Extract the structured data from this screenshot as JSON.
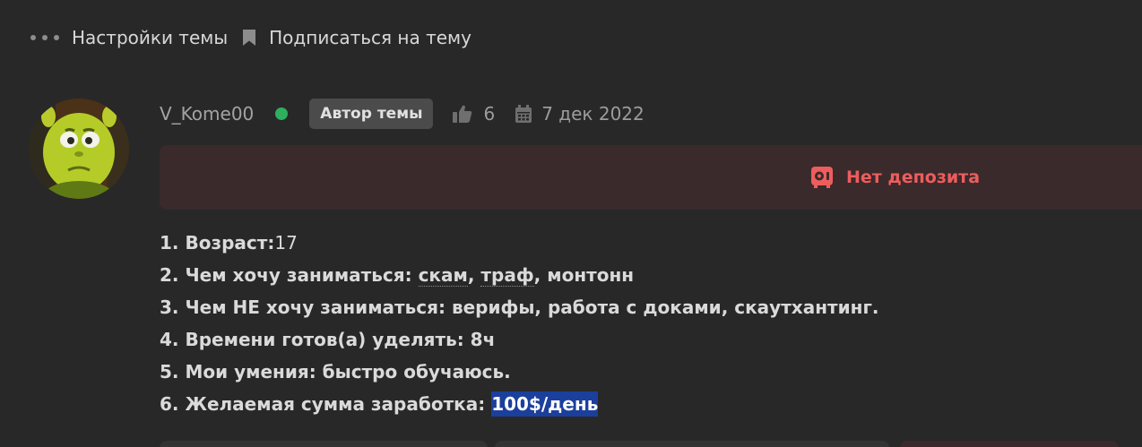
{
  "topbar": {
    "settings_label": "Настройки темы",
    "subscribe_label": "Подписаться на тему"
  },
  "post": {
    "username": "V_Kome00",
    "badge": "Автор темы",
    "likes": "6",
    "date": "7 дек 2022",
    "deposit_label": "Нет депозита",
    "lines": {
      "l1a": "1. Возраст:",
      "l1b": "17",
      "l2a": "2. Чем хочу заниматься: ",
      "l2b": "скам",
      "l2c": ", ",
      "l2d": "траф",
      "l2e": ", монтонн",
      "l3": "3. Чем НЕ хочу заниматься: верифы, работа с доками, скаутхантинг.",
      "l4": "4. Времени готов(а) уделять: 8ч",
      "l5": "5. Мои умения: быстро обучаюсь.",
      "l6a": "6. Желаемая сумма заработка: ",
      "l6b": "100$/день"
    }
  },
  "colors": {
    "background": "#282828",
    "online": "#2eae5e",
    "deposit_text": "#ee5d5d",
    "deposit_bg": "#3a2a2b",
    "highlight": "#1b3f9c"
  },
  "icons": [
    "more-dots-icon",
    "bookmark-icon",
    "thumbs-up-icon",
    "calendar-icon",
    "no-deposit-icon"
  ]
}
